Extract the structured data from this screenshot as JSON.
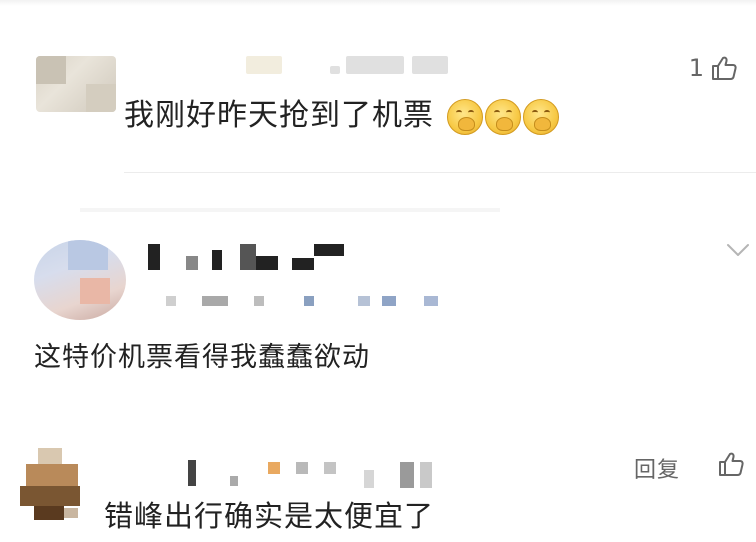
{
  "comments": [
    {
      "text": "我刚好昨天抢到了机票",
      "emojis": [
        "hand-over-mouth-emoji",
        "hand-over-mouth-emoji",
        "hand-over-mouth-emoji"
      ],
      "like_count": "1"
    },
    {
      "text": "这特价机票看得我蠢蠢欲动"
    },
    {
      "text": "错峰出行确实是太便宜了",
      "reply_label": "回复"
    }
  ],
  "icons": {
    "like": "thumbs-up-icon",
    "expand": "chevron-down-icon"
  },
  "colors": {
    "text": "#222222",
    "secondary": "#666666",
    "divider": "#ececec",
    "emoji": "#f7c945"
  }
}
